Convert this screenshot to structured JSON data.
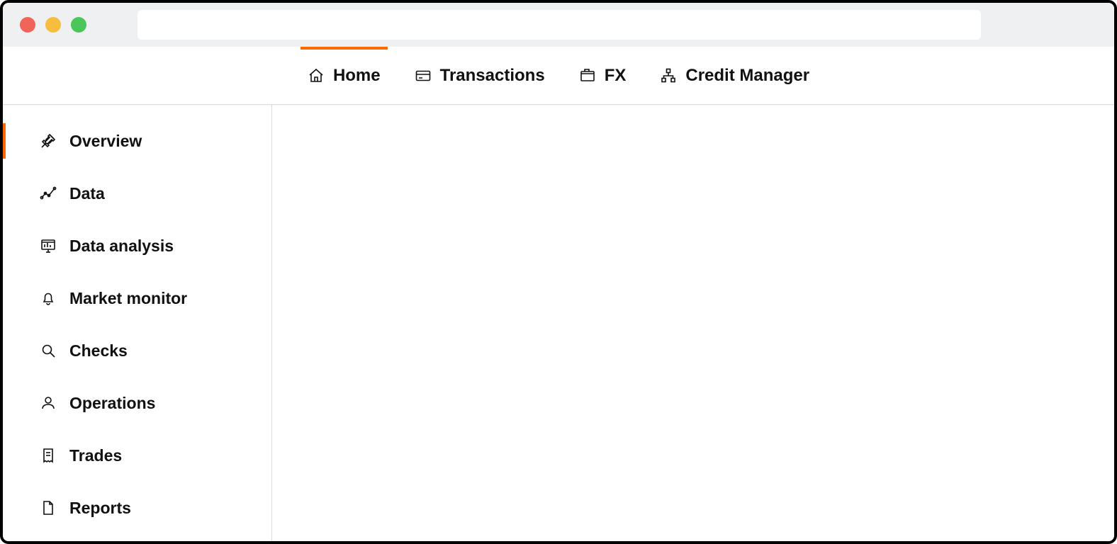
{
  "colors": {
    "accent": "#ff6a00"
  },
  "nav": {
    "tabs": [
      {
        "label": "Home"
      },
      {
        "label": "Transactions"
      },
      {
        "label": "FX"
      },
      {
        "label": "Credit Manager"
      }
    ]
  },
  "sidebar": {
    "items": [
      {
        "label": "Overview"
      },
      {
        "label": "Data"
      },
      {
        "label": "Data analysis"
      },
      {
        "label": "Market monitor"
      },
      {
        "label": "Checks"
      },
      {
        "label": "Operations"
      },
      {
        "label": "Trades"
      },
      {
        "label": "Reports"
      }
    ]
  }
}
